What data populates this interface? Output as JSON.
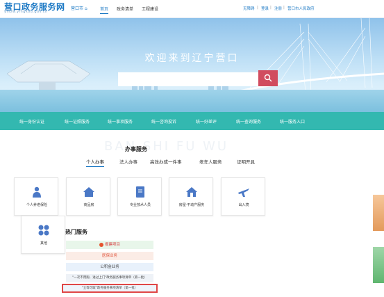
{
  "header": {
    "title": "营口政务服务网",
    "subtitle": "ymzw.yingkou.gov.cn",
    "city": "营口市 ⌂",
    "nav": [
      "首页",
      "政务清单",
      "工程建设"
    ],
    "util": [
      "无障碍",
      "登录",
      "注册",
      "营口市人民政府"
    ]
  },
  "hero": {
    "welcome": "欢迎来到辽宁营口",
    "search_placeholder": ""
  },
  "strip": [
    "统一身份认证",
    "统一证照服务",
    "统一事项服务",
    "统一咨询投诉",
    "统一好差评",
    "统一查询服务",
    "统一服务入口"
  ],
  "services": {
    "watermark": "BAN SHI FU WU",
    "title": "办事服务",
    "tabs": [
      "个人办事",
      "法人办事",
      "高效办成一件事",
      "老年人服务",
      "证明开具"
    ],
    "cards": [
      {
        "label": "个人养老保险",
        "icon": "pension-icon"
      },
      {
        "label": "商品房",
        "icon": "house-icon"
      },
      {
        "label": "专业技术人员",
        "icon": "document-icon"
      },
      {
        "label": "房屋·不动产服务",
        "icon": "property-icon"
      },
      {
        "label": "出入境",
        "icon": "plane-icon"
      },
      {
        "label": "其他",
        "icon": "grid-icon"
      }
    ]
  },
  "hot": {
    "title": "热门服务",
    "items": [
      "报建项目",
      "医保业务",
      "公积金业务",
      "\"一次不用跑、进过上门\"政务服务事项清单（第一批）",
      "\"立等可取\"政务服务事项清单（第一批）"
    ]
  },
  "colors": {
    "brand": "#1b78c4",
    "strip": "#33b8b0",
    "search_button": "#d14c5f",
    "highlight": "#e04646"
  }
}
